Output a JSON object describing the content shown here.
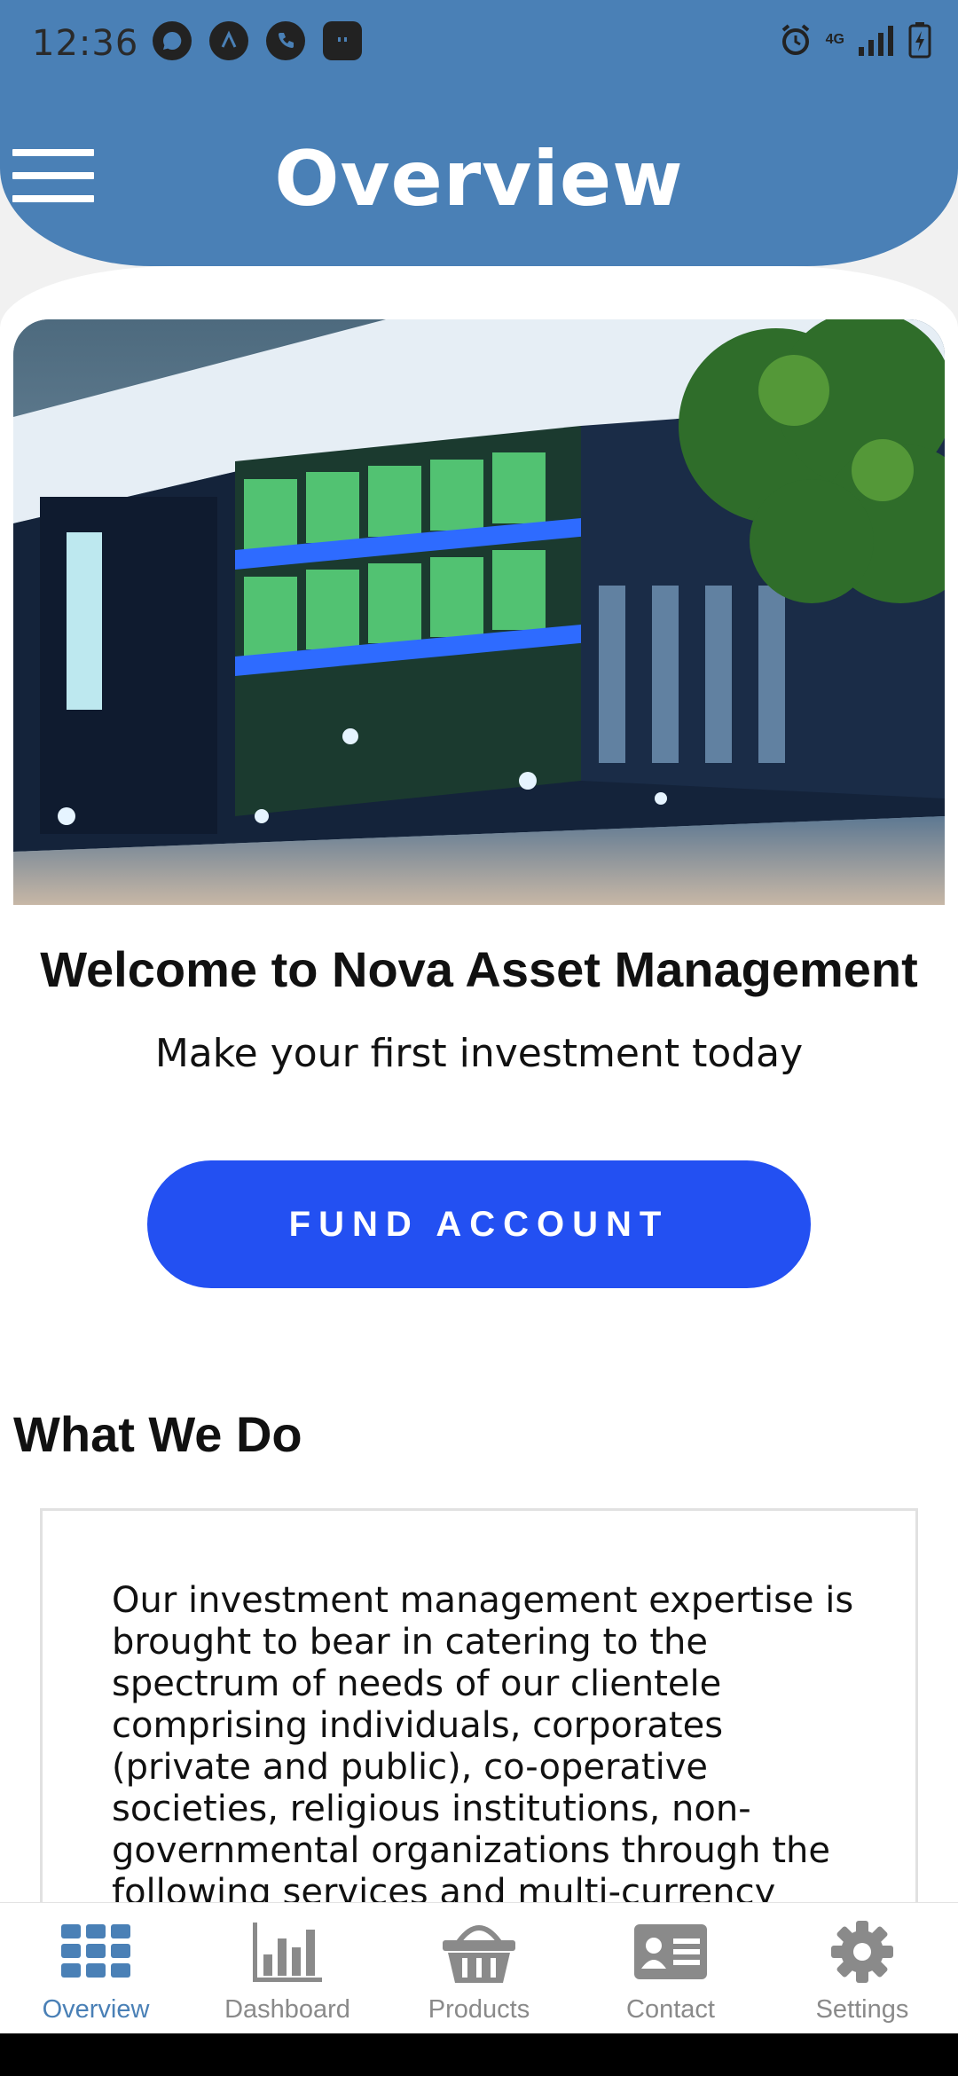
{
  "status_bar": {
    "time": "12:36",
    "network": "4G"
  },
  "header": {
    "title": "Overview"
  },
  "main": {
    "welcome_title": "Welcome to Nova Asset Management",
    "tagline": "Make your first investment today",
    "fund_button_label": "FUND ACCOUNT",
    "section_title": "What We Do",
    "description": "Our investment management expertise is brought to bear in catering to the spectrum of needs of our clientele comprising individuals, corporates (private and public), co-operative societies, religious institutions, non-governmental organizations through the following services and multi-currency denominated"
  },
  "bottom_nav": {
    "items": [
      {
        "label": "Overview",
        "icon": "grid-icon",
        "active": true
      },
      {
        "label": "Dashboard",
        "icon": "bar-chart-icon",
        "active": false
      },
      {
        "label": "Products",
        "icon": "basket-icon",
        "active": false
      },
      {
        "label": "Contact",
        "icon": "contact-card-icon",
        "active": false
      },
      {
        "label": "Settings",
        "icon": "gear-icon",
        "active": false
      }
    ]
  },
  "colors": {
    "header": "#4a80b6",
    "primary_button": "#2350f2",
    "active_nav": "#4a80b6",
    "inactive_nav": "#8a8a8a"
  }
}
